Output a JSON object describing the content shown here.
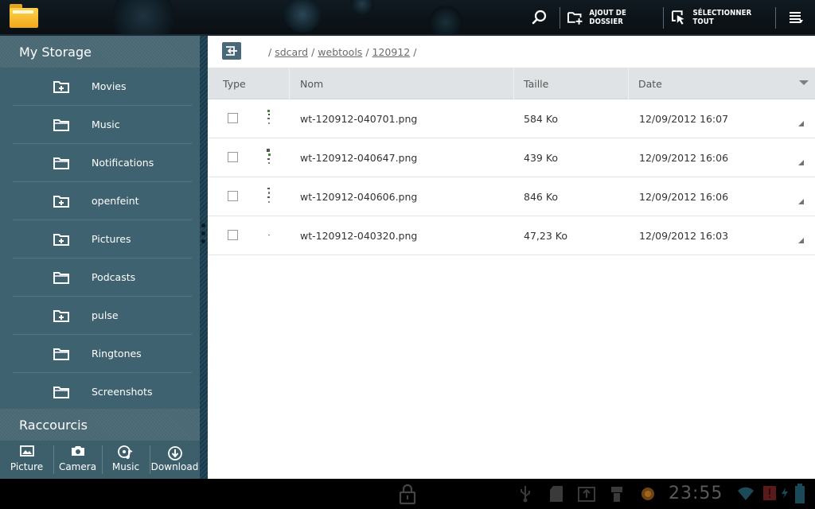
{
  "action_bar": {
    "add_folder_label": "AJOUT DE DOSSIER",
    "select_all_label": "SÉLECTIONNER TOUT"
  },
  "drawer": {
    "title": "My Storage",
    "items": [
      {
        "label": "Movies",
        "icon": "folder-plus-icon"
      },
      {
        "label": "Music",
        "icon": "folder-icon"
      },
      {
        "label": "Notifications",
        "icon": "folder-icon"
      },
      {
        "label": "openfeint",
        "icon": "folder-plus-icon"
      },
      {
        "label": "Pictures",
        "icon": "folder-plus-icon"
      },
      {
        "label": "Podcasts",
        "icon": "folder-icon"
      },
      {
        "label": "pulse",
        "icon": "folder-plus-icon"
      },
      {
        "label": "Ringtones",
        "icon": "folder-icon"
      },
      {
        "label": "Screenshots",
        "icon": "folder-icon"
      }
    ],
    "shortcuts_title": "Raccourcis",
    "shortcuts": [
      {
        "label": "Picture",
        "icon": "image-icon"
      },
      {
        "label": "Camera",
        "icon": "camera-icon"
      },
      {
        "label": "Music",
        "icon": "music-icon"
      },
      {
        "label": "Download",
        "icon": "download-icon"
      }
    ]
  },
  "breadcrumb": {
    "segments": [
      "sdcard",
      "webtools",
      "120912"
    ]
  },
  "table": {
    "columns": {
      "type": "Type",
      "name": "Nom",
      "size": "Taille",
      "date": "Date"
    },
    "rows": [
      {
        "name": "wt-120912-040701.png",
        "size": "584 Ko",
        "date": "12/09/2012 16:07"
      },
      {
        "name": "wt-120912-040647.png",
        "size": "439 Ko",
        "date": "12/09/2012 16:06"
      },
      {
        "name": "wt-120912-040606.png",
        "size": "846 Ko",
        "date": "12/09/2012 16:06"
      },
      {
        "name": "wt-120912-040320.png",
        "size": "47,23 Ko",
        "date": "12/09/2012 16:03"
      }
    ]
  },
  "system_bar": {
    "clock": "23:55"
  }
}
